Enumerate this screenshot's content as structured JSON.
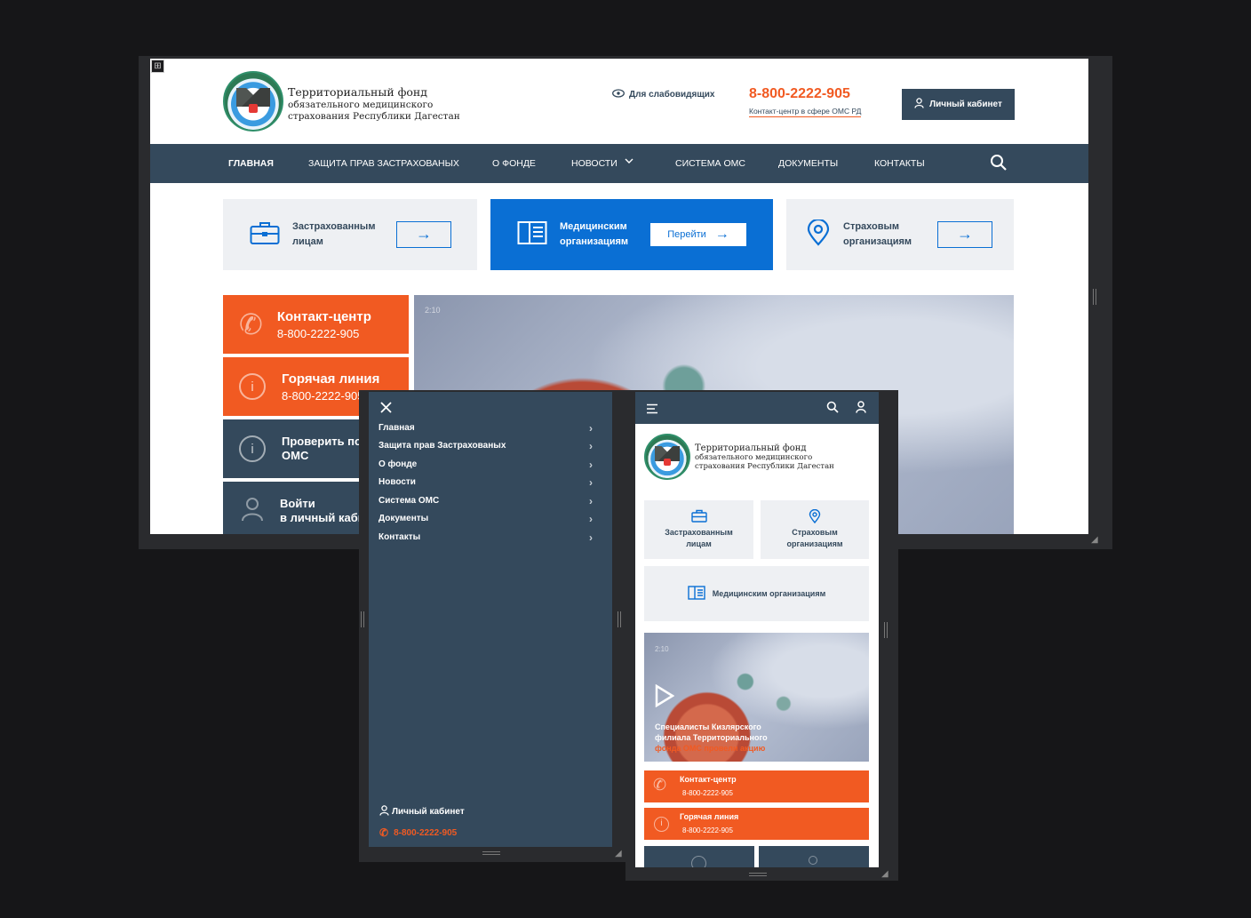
{
  "org": {
    "name_line1": "Территориальный фонд",
    "name_line2": "обязательного медицинского",
    "name_line3": "страхования Республики Дагестан"
  },
  "header": {
    "accessibility_label": "Для слабовидящих",
    "phone": "8-800-2222-905",
    "phone_caption": "Контакт-центр в сфере ОМС РД",
    "cabinet_button": "Личный кабинет"
  },
  "nav": {
    "items": [
      {
        "label": "ГЛАВНАЯ"
      },
      {
        "label": "ЗАЩИТА ПРАВ ЗАСТРАХОВАНЫХ"
      },
      {
        "label": "О ФОНДЕ"
      },
      {
        "label": "НОВОСТИ"
      },
      {
        "label": "СИСТЕМА ОМС"
      },
      {
        "label": "ДОКУМЕНТЫ"
      },
      {
        "label": "КОНТАКТЫ"
      }
    ]
  },
  "cards": [
    {
      "line1": "Застрахованным",
      "line2": "лицам",
      "icon": "briefcase-icon"
    },
    {
      "line1": "Медицинским",
      "line2": "организациям",
      "button": "Перейти",
      "icon": "book-icon"
    },
    {
      "line1": "Страховым",
      "line2": "организациям",
      "icon": "location-pin-icon"
    }
  ],
  "tiles": [
    {
      "title": "Контакт-центр",
      "sub": "8-800-2222-905",
      "icon": "phone-icon"
    },
    {
      "title": "Горячая линия",
      "sub": "8-800-2222-905",
      "icon": "info-icon"
    },
    {
      "title": "Проверить по",
      "sub": "ОМС",
      "icon": "info-icon"
    },
    {
      "title": "Войти",
      "sub": "в личный каби",
      "icon": "user-icon"
    }
  ],
  "video": {
    "duration": "2:10",
    "caption_line1": "Специалисты Кизлярского",
    "caption_line2": "филиала Территориального",
    "caption_line3": "фонда ОМС провели акцию"
  },
  "menu": {
    "items": [
      {
        "label": "Главная"
      },
      {
        "label": "Защита прав Застрахованых"
      },
      {
        "label": "О фонде"
      },
      {
        "label": "Новости"
      },
      {
        "label": "Система ОМС"
      },
      {
        "label": "Документы"
      },
      {
        "label": "Контакты"
      }
    ],
    "cabinet": "Личный кабинет",
    "phone": "8-800-2222-905"
  },
  "mobile": {
    "cards": [
      {
        "line1": "Застрахованным",
        "line2": "лицам"
      },
      {
        "line1": "Страховым",
        "line2": "организациям"
      },
      {
        "line1": "Медицинским организациям"
      }
    ],
    "tiles": [
      {
        "title": "Контакт-центр",
        "sub": "8-800-2222-905"
      },
      {
        "title": "Горячая линия",
        "sub": "8-800-2222-905"
      }
    ]
  },
  "colors": {
    "primary_dark": "#34495c",
    "accent_blue": "#0a6fd4",
    "accent_orange": "#f15a22",
    "background": "#161618"
  }
}
